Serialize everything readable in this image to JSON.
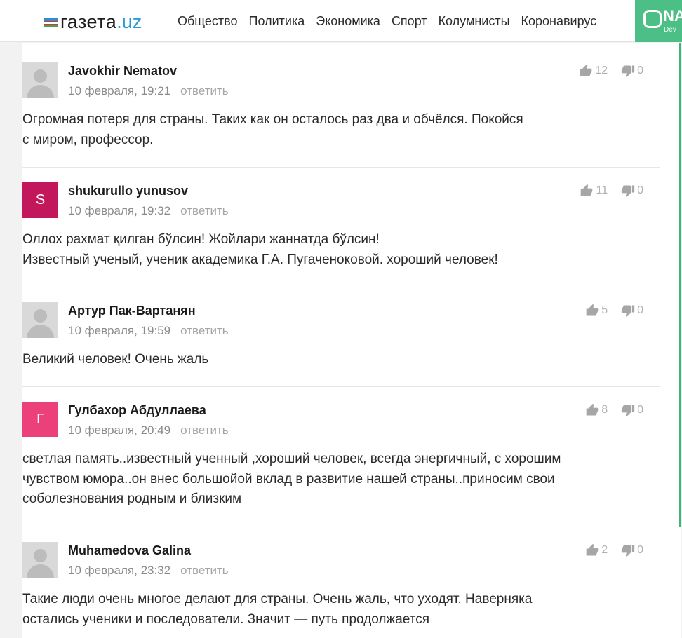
{
  "header": {
    "logo_text": "газета",
    "logo_suffix": ".uz",
    "nav": [
      "Общество",
      "Политика",
      "Экономика",
      "Спорт",
      "Колумнисты",
      "Коронавирус"
    ],
    "promo": {
      "text": "NA",
      "sub": "Dev"
    }
  },
  "comments": [
    {
      "author": "Javokhir Nematov",
      "avatar": {
        "type": "placeholder"
      },
      "date": "10 февраля, 19:21",
      "reply": "ответить",
      "likes": "12",
      "dislikes": "0",
      "text_lines": [
        "Огромная потеря для страны. Таких как он осталось раз два и обчёлся. Покойся",
        "с миром, профессор."
      ]
    },
    {
      "author": "shukurullo yunusov",
      "avatar": {
        "type": "letter",
        "letter": "S",
        "color": "#c2185b"
      },
      "date": "10 февраля, 19:32",
      "reply": "ответить",
      "likes": "11",
      "dislikes": "0",
      "text_lines": [
        "Оллох рахмат қилган бўлсин! Жойлари жаннатда бўлсин!",
        "Известный ученый, ученик академика Г.А. Пугаченоковой. хороший человек!"
      ]
    },
    {
      "author": "Артур Пак-Вартанян",
      "avatar": {
        "type": "placeholder"
      },
      "date": "10 февраля, 19:59",
      "reply": "ответить",
      "likes": "5",
      "dislikes": "0",
      "text_lines": [
        "Великий человек! Очень жаль"
      ]
    },
    {
      "author": "Гулбахор Абдуллаева",
      "avatar": {
        "type": "letter",
        "letter": "Г",
        "color": "#ec407a"
      },
      "date": "10 февраля, 20:49",
      "reply": "ответить",
      "likes": "8",
      "dislikes": "0",
      "text_lines": [
        "светлая память..известный ученный ,хороший человек, всегда энергичный, с хорошим",
        "чувством юмора..он внес большойой вклад в развитие нашей страны..приносим свои",
        "соболезнования родным и близким"
      ]
    },
    {
      "author": "Muhamedova Galina",
      "avatar": {
        "type": "placeholder"
      },
      "date": "10 февраля, 23:32",
      "reply": "ответить",
      "likes": "2",
      "dislikes": "0",
      "text_lines": [
        "Такие люди очень многое делают для страны. Очень жаль, что уходят. Наверняка",
        "остались ученики и последователи. Значит — путь продолжается"
      ]
    }
  ]
}
